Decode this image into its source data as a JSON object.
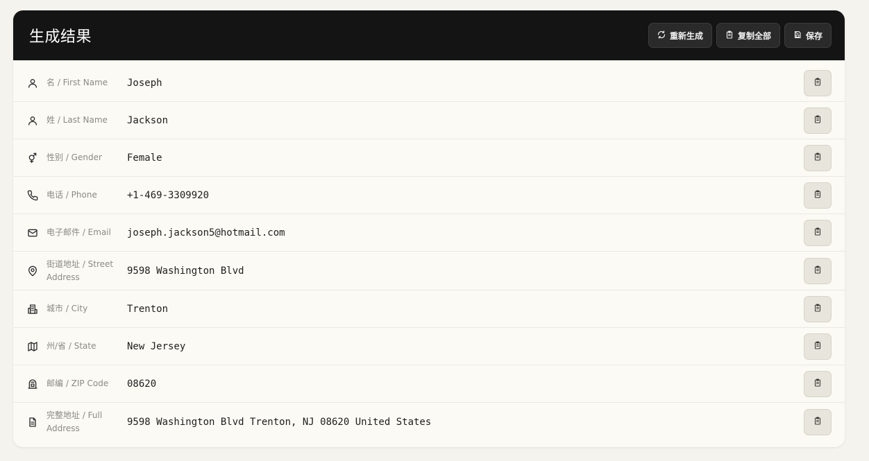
{
  "header": {
    "title": "生成结果",
    "buttons": {
      "regenerate": "重新生成",
      "copy_all": "复制全部",
      "save": "保存"
    }
  },
  "fields": [
    {
      "label": "名 / First Name",
      "value": "Joseph",
      "icon": "user-icon"
    },
    {
      "label": "姓 / Last Name",
      "value": "Jackson",
      "icon": "user-icon"
    },
    {
      "label": "性别 / Gender",
      "value": "Female",
      "icon": "gender-icon"
    },
    {
      "label": "电话 / Phone",
      "value": "+1-469-3309920",
      "icon": "phone-icon"
    },
    {
      "label": "电子邮件 / Email",
      "value": "joseph.jackson5@hotmail.com",
      "icon": "mail-icon"
    },
    {
      "label": "街道地址 / Street Address",
      "value": "9598 Washington Blvd",
      "icon": "map-pin-icon"
    },
    {
      "label": "城市 / City",
      "value": "Trenton",
      "icon": "building-icon"
    },
    {
      "label": "州/省 / State",
      "value": "New Jersey",
      "icon": "map-icon"
    },
    {
      "label": "邮编 / ZIP Code",
      "value": "08620",
      "icon": "mailbox-icon"
    },
    {
      "label": "完整地址 / Full Address",
      "value": "9598 Washington Blvd Trenton, NJ 08620 United States",
      "icon": "document-icon"
    }
  ]
}
